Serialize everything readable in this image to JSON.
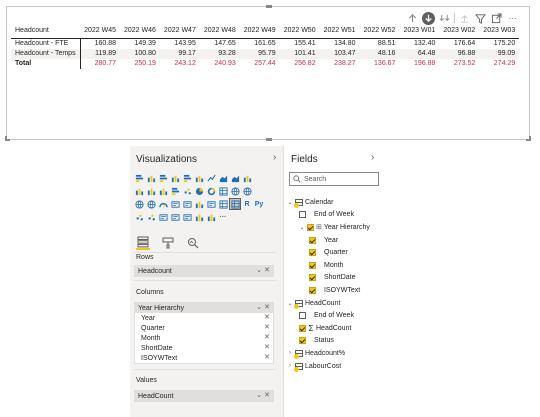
{
  "matrix": {
    "row_header": "Headcount",
    "columns": [
      "2022 W45",
      "2022 W46",
      "2022 W47",
      "2022 W48",
      "2022 W49",
      "2022 W50",
      "2022 W51",
      "2022 W52",
      "2023 W01",
      "2023 W02",
      "2023 W03"
    ],
    "rows": [
      {
        "label": "Headcount - FTE",
        "values": [
          "160.88",
          "149.39",
          "143.95",
          "147.65",
          "161.65",
          "155.41",
          "134.80",
          "88.51",
          "132.40",
          "176.64",
          "175.20"
        ]
      },
      {
        "label": "Headcount - Temps",
        "values": [
          "119.89",
          "100.80",
          "99.17",
          "93.28",
          "95.79",
          "101.41",
          "103.47",
          "48.16",
          "64.48",
          "96.88",
          "99.09"
        ]
      },
      {
        "label": "Total",
        "values": [
          "280.77",
          "250.19",
          "243.12",
          "240.93",
          "257.44",
          "256.82",
          "238.27",
          "136.67",
          "196.88",
          "273.52",
          "274.29"
        ]
      }
    ]
  },
  "toolbar": {
    "icons": [
      "arrow-up-icon",
      "drill-down-icon",
      "expand-hierarchy-icon",
      "drill-up-icon",
      "filter-icon",
      "focus-mode-icon",
      "more-options-icon"
    ]
  },
  "visualizations": {
    "title": "Visualizations",
    "chevron": "›",
    "sub_tabs": [
      "build-visual",
      "format-visual",
      "analytics"
    ],
    "rows_label": "Rows",
    "rows_field": "Headcount",
    "columns_label": "Columns",
    "columns_group": "Year Hierarchy",
    "columns_fields": [
      "Year",
      "Quarter",
      "Month",
      "ShortDate",
      "ISOYWText"
    ],
    "values_label": "Values",
    "values_field": "HeadCount",
    "grid_letters": {
      "r": "R",
      "py": "Py",
      "more": "···"
    }
  },
  "fields": {
    "title": "Fields",
    "chevron": "›",
    "search_placeholder": "Search",
    "tree": [
      {
        "label": "Calendar",
        "type": "table",
        "expanded": true
      },
      {
        "label": "End of Week",
        "type": "field",
        "checked": false
      },
      {
        "label": "Year Hierarchy",
        "type": "hierarchy",
        "checked": true
      },
      {
        "label": "Year",
        "type": "level",
        "checked": true
      },
      {
        "label": "Quarter",
        "type": "level",
        "checked": true
      },
      {
        "label": "Month",
        "type": "level",
        "checked": true
      },
      {
        "label": "ShortDate",
        "type": "level",
        "checked": true
      },
      {
        "label": "ISOYWText",
        "type": "level",
        "checked": true
      },
      {
        "label": "HeadCount",
        "type": "table",
        "expanded": true
      },
      {
        "label": "End of Week",
        "type": "field",
        "checked": false
      },
      {
        "label": "HeadCount",
        "type": "measure",
        "checked": true
      },
      {
        "label": "Status",
        "type": "field",
        "checked": true
      },
      {
        "label": "Headcount%",
        "type": "table",
        "expanded": false
      },
      {
        "label": "LabourCost",
        "type": "table",
        "expanded": false
      }
    ]
  },
  "colors": {
    "accent": "#f2c811",
    "total": "#c4314b",
    "pane": "#f3f2f1"
  }
}
